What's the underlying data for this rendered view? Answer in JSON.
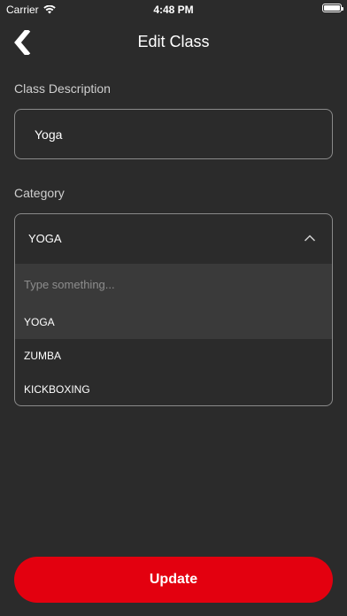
{
  "status_bar": {
    "carrier": "Carrier",
    "time": "4:48 PM"
  },
  "nav": {
    "title": "Edit Class",
    "back_icon": "back-chevron-icon"
  },
  "form": {
    "description_label": "Class Description",
    "description_value": "Yoga",
    "category_label": "Category",
    "category_selected": "YOGA",
    "search_placeholder": "Type something...",
    "options": [
      "YOGA",
      "ZUMBA",
      "KICKBOXING"
    ],
    "selected_index": 0
  },
  "actions": {
    "update_label": "Update"
  },
  "colors": {
    "background": "#2b2b2b",
    "accent": "#e3000f",
    "border": "#8a8a8a",
    "highlight": "#3a3a3a"
  }
}
